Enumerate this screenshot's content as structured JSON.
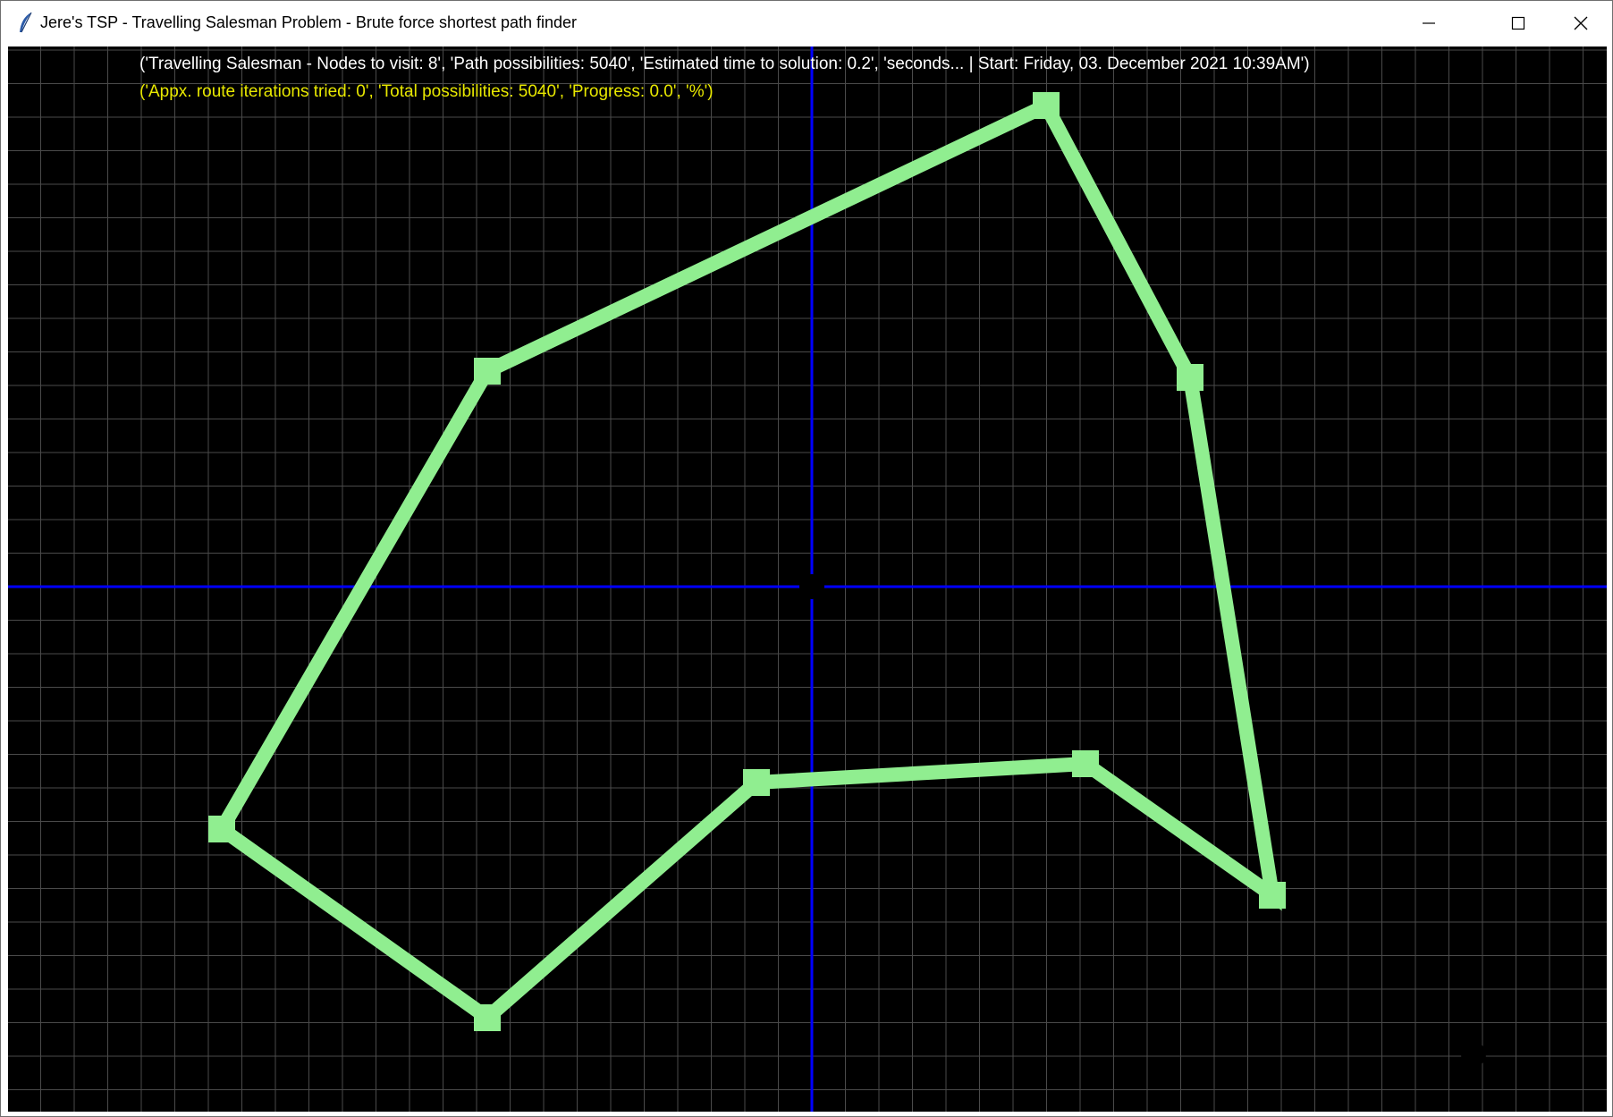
{
  "window": {
    "title": "Jere's TSP - Travelling Salesman Problem - Brute force shortest path finder",
    "icon": "feather-icon",
    "controls": [
      "minimize-icon",
      "maximize-icon",
      "close-icon"
    ]
  },
  "status": {
    "line1": "('Travelling Salesman - Nodes to visit: 8', 'Path possibilities: 5040', 'Estimated time to solution: 0.2', 'seconds...  |  Start: Friday, 03. December 2021 10:39AM')",
    "line2": "('Appx. route iterations tried: 0', 'Total possibilities: 5040', 'Progress: 0.0', '%')"
  },
  "colors": {
    "background": "#000000",
    "grid": "#4a4a4a",
    "axis": "#0000ff",
    "route": "#90ee90",
    "status_line1": "#ffffff",
    "status_line2": "#e8e800"
  }
}
